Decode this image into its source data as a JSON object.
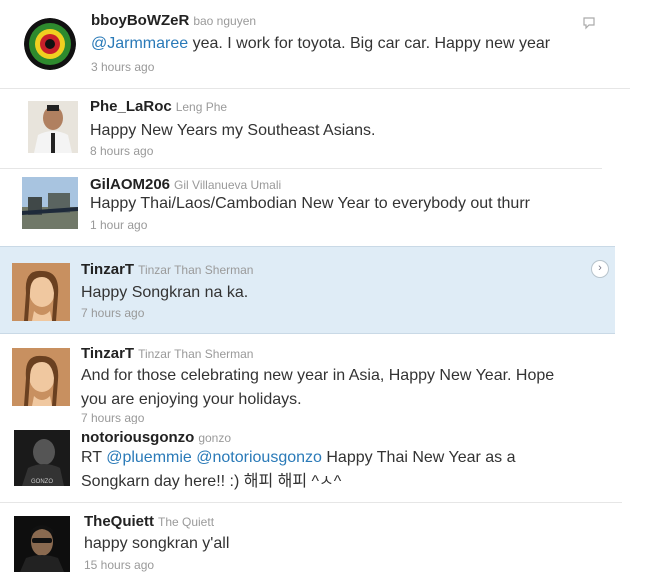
{
  "tweets": [
    {
      "handle": "bboyBoWZeR",
      "fullname": "bao nguyen",
      "text_parts": [
        {
          "t": "@Jarmmaree",
          "link": true
        },
        {
          "t": " yea. I work for toyota. Big car car. Happy new year",
          "link": false
        }
      ],
      "time": "3 hours ago"
    },
    {
      "handle": "Phe_LaRoc",
      "fullname": "Leng Phe",
      "text": "Happy New Years my Southeast Asians.",
      "time": "8 hours ago"
    },
    {
      "handle": "GilAOM206",
      "fullname": "Gil Villanueva Umali",
      "text": "Happy Thai/Laos/Cambodian New Year to everybody out thurr",
      "time": "1 hour ago"
    },
    {
      "handle": "TinzarT",
      "fullname": "Tinzar Than Sherman",
      "text": "Happy Songkran na ka.",
      "time": "7 hours ago"
    },
    {
      "handle": "TinzarT",
      "fullname": "Tinzar Than Sherman",
      "line1": "And for those celebrating new year in Asia, Happy New Year. Hope",
      "line2": "you are enjoying your holidays.",
      "time": "7 hours ago"
    },
    {
      "handle": "notoriousgonzo",
      "fullname": "gonzo",
      "l1a": "RT ",
      "l1b": "@pluemmie",
      "l1c": " ",
      "l1d": "@notoriousgonzo",
      "l1e": " Happy Thai New Year as a",
      "line2": "Songkarn day here!! :) 해피 해피 ^ㅅ^",
      "avatar_caption": "GONZO"
    },
    {
      "handle": "TheQuiett",
      "fullname": "The Quiett",
      "text": "happy songkran y'all",
      "time": "15 hours ago"
    }
  ],
  "icons": {
    "reply": "reply-icon",
    "expand": "chevron-right-icon",
    "expand_glyph": "›"
  },
  "colors": {
    "link": "#2a7ab8",
    "highlight": "#dfecf6"
  }
}
